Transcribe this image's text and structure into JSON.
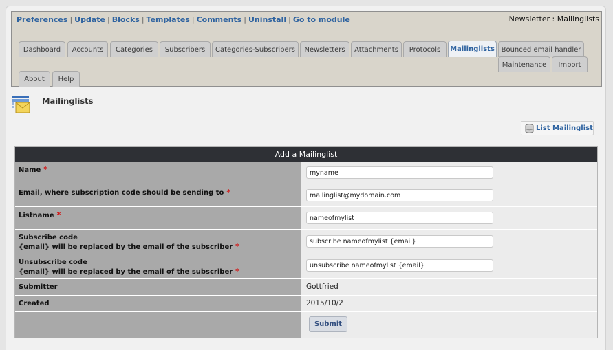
{
  "admin_links": [
    "Preferences",
    "Update",
    "Blocks",
    "Templates",
    "Comments",
    "Uninstall",
    "Go to module"
  ],
  "module_title": "Newsletter : Mailinglists",
  "tabs": [
    "Dashboard",
    "Accounts",
    "Categories",
    "Subscribers",
    "Categories-Subscribers",
    "Newsletters",
    "Attachments",
    "Protocols",
    "Mailinglists",
    "Bounced email handler",
    "Maintenance",
    "Import",
    "About",
    "Help"
  ],
  "active_tab": "Mailinglists",
  "page_title": "Mailinglists",
  "list_button": "List Mailinglist",
  "form": {
    "title": "Add a Mailinglist",
    "name_label": "Name",
    "name_value": "myname",
    "email_label": "Email, where subscription code should be sending to",
    "email_value": "mailinglist@mydomain.com",
    "listname_label": "Listname",
    "listname_value": "nameofmylist",
    "subscribe_label_1": "Subscribe code",
    "subscribe_label_2": "{email} will be replaced by the email of the subscriber",
    "subscribe_value": "subscribe nameofmylist {email}",
    "unsubscribe_label_1": "Unsubscribe code",
    "unsubscribe_label_2": "{email} will be replaced by the email of the subscriber",
    "unsubscribe_value": "unsubscribe nameofmylist {email}",
    "submitter_label": "Submitter",
    "submitter_value": "Gottfried",
    "created_label": "Created",
    "created_value": "2015/10/2",
    "required_mark": "*",
    "submit_label": "Submit"
  },
  "colors": {
    "link": "#2f63a0",
    "header_bg": "#2e3035",
    "label_bg": "#a9a9a9",
    "required": "#d21a1a"
  }
}
